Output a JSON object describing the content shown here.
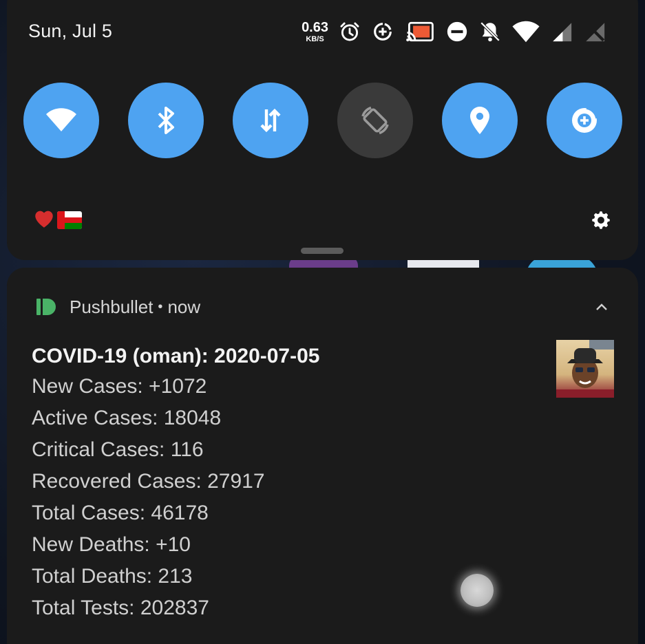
{
  "status_bar": {
    "date": "Sun, Jul 5",
    "net_speed_value": "0.63",
    "net_speed_unit": "KB/S",
    "icons": [
      "alarm-icon",
      "data-saver-icon",
      "cast-icon",
      "do-not-disturb-icon",
      "notifications-off-icon",
      "wifi-icon",
      "signal-icon",
      "no-sim-icon"
    ]
  },
  "quick_settings": {
    "tiles": [
      {
        "name": "wifi",
        "icon": "wifi-icon",
        "state": "on"
      },
      {
        "name": "bluetooth",
        "icon": "bluetooth-icon",
        "state": "on"
      },
      {
        "name": "mobile-data",
        "icon": "data-transfer-icon",
        "state": "on"
      },
      {
        "name": "auto-rotate",
        "icon": "rotate-icon",
        "state": "off"
      },
      {
        "name": "location",
        "icon": "location-pin-icon",
        "state": "on"
      },
      {
        "name": "data-saver",
        "icon": "data-saver-icon",
        "state": "on"
      }
    ],
    "accent_color": "#4ea3f1",
    "off_color": "#3a3a3a",
    "footer_icons": [
      "heart-icon",
      "oman-flag-icon"
    ],
    "settings_icon": "gear-icon"
  },
  "notification": {
    "app_name": "Pushbullet",
    "separator": "•",
    "time": "now",
    "app_icon_color": "#4ab367",
    "title": "COVID-19 (oman): 2020-07-05",
    "lines": [
      "New Cases: +1072",
      "Active Cases: 18048",
      "Critical Cases: 116",
      "Recovered Cases: 27917",
      "Total Cases: 46178",
      "New Deaths: +10",
      "Total Deaths: 213",
      "Total Tests: 202837"
    ]
  }
}
